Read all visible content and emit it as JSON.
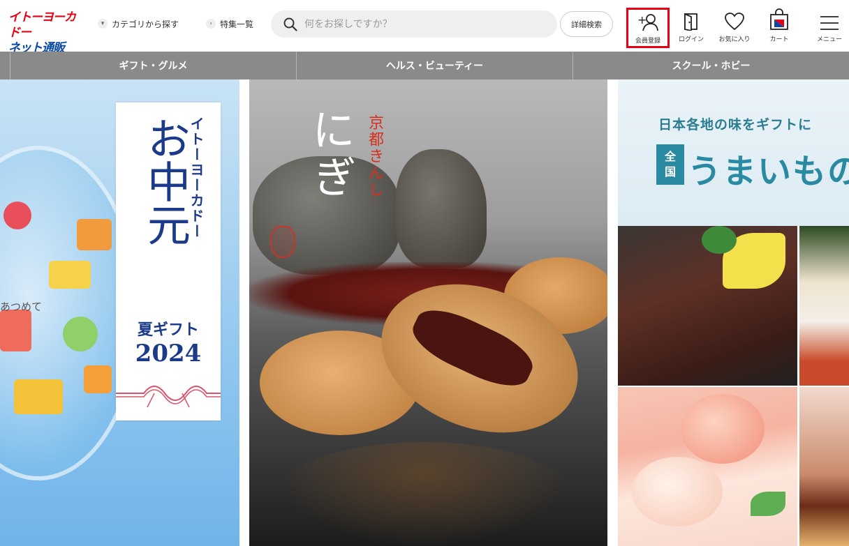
{
  "header": {
    "logo": {
      "line1": "イトーヨーカドー",
      "line2": "ネット通販"
    },
    "nav": [
      {
        "label": "カテゴリから探す"
      },
      {
        "label": "特集一覧"
      }
    ],
    "search": {
      "placeholder": "何をお探しですか？",
      "value": ""
    },
    "advanced_search_label": "詳細検索",
    "icons": {
      "member": {
        "label": "会員登録",
        "icon": "add-user-icon"
      },
      "login": {
        "label": "ログイン",
        "icon": "door-icon"
      },
      "favorites": {
        "label": "お気に入り",
        "icon": "heart-icon"
      },
      "cart": {
        "label": "カート",
        "icon": "shopping-bag-icon"
      },
      "menu": {
        "label": "メニュー",
        "icon": "hamburger-icon"
      }
    },
    "highlight_color": "#e60012"
  },
  "categories": [
    {
      "label": "ギフト・グルメ"
    },
    {
      "label": "ヘルス・ビューティー"
    },
    {
      "label": "スクール・ホビー"
    }
  ],
  "banners": {
    "ochugen": {
      "brand": "イトーヨーカドー",
      "title": "お中元",
      "subtitle": "夏ギフト",
      "year": "2024",
      "side_text": "あつめて"
    },
    "nigi": {
      "title": "にぎ",
      "brand": "京都きんし"
    },
    "umaimono": {
      "tagline": "日本各地の味をギフトに",
      "badge_line1": "全",
      "badge_line2": "国",
      "title": "うまいもの"
    }
  }
}
